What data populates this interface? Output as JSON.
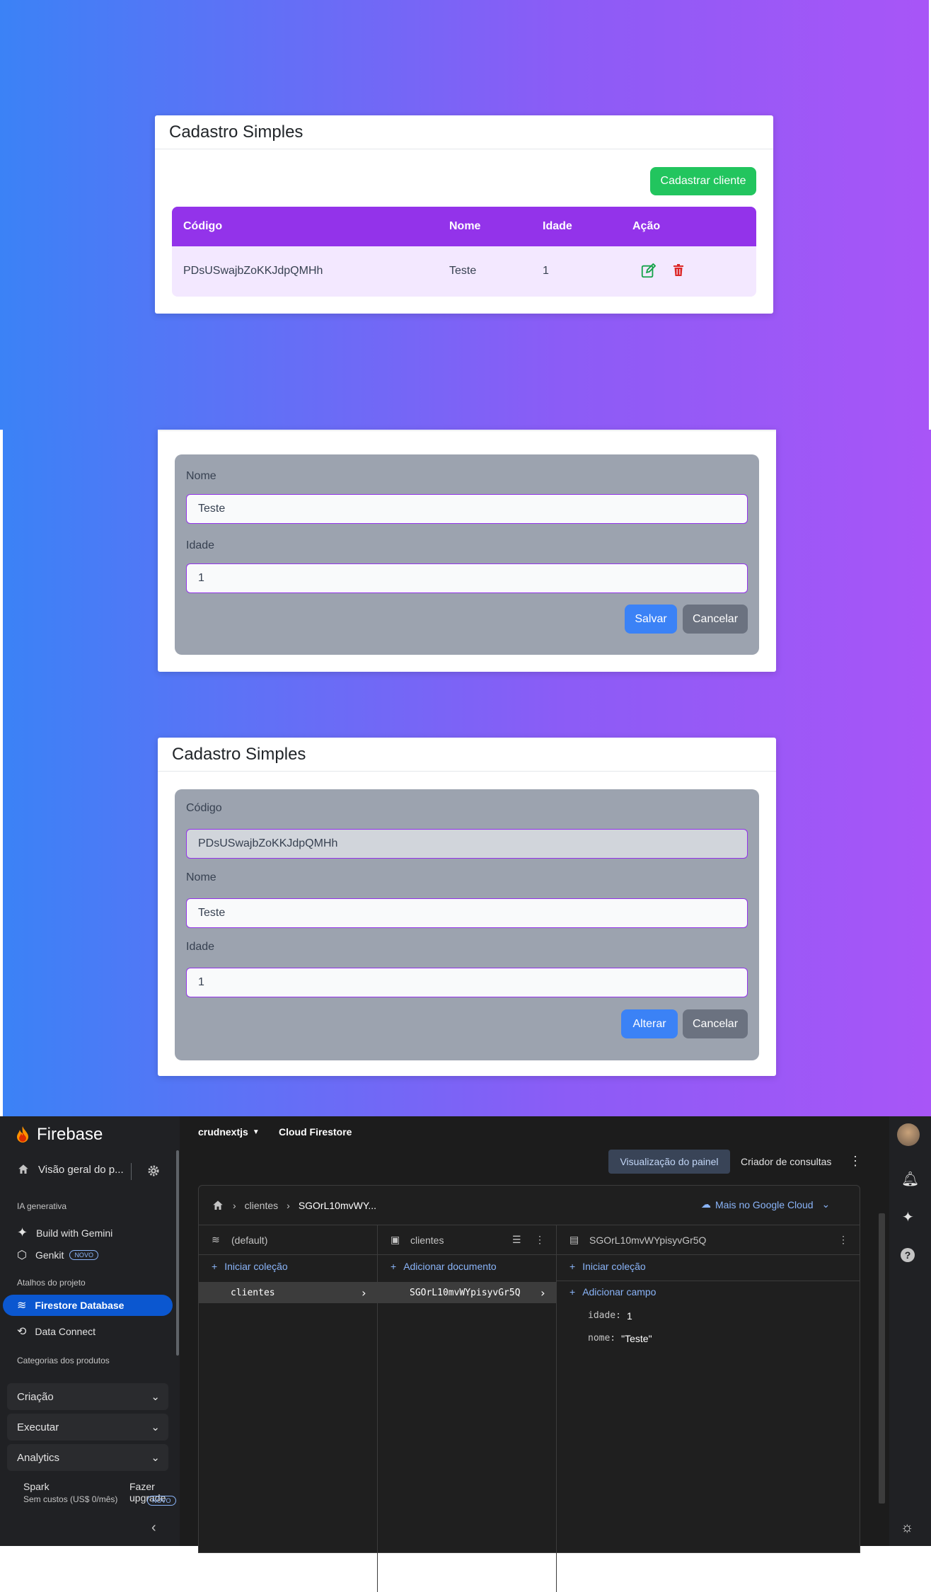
{
  "screen1": {
    "title": "Cadastro Simples",
    "add_button": "Cadastrar cliente",
    "table": {
      "headers": [
        "Código",
        "Nome",
        "Idade",
        "Ação"
      ],
      "rows": [
        {
          "codigo": "PDsUSwajbZoKKJdpQMHh",
          "nome": "Teste",
          "idade": "1"
        }
      ]
    },
    "colors": {
      "header": "#9333ea",
      "row": "#f3e8ff",
      "add": "#22c55e",
      "edit": "#16a34a",
      "delete": "#dc2626"
    }
  },
  "screen2": {
    "fields": [
      {
        "label": "Nome",
        "value": "Teste"
      },
      {
        "label": "Idade",
        "value": "1"
      }
    ],
    "save": "Salvar",
    "cancel": "Cancelar"
  },
  "screen3": {
    "title": "Cadastro Simples",
    "fields": [
      {
        "label": "Código",
        "value": "PDsUSwajbZoKKJdpQMHh"
      },
      {
        "label": "Nome",
        "value": "Teste"
      },
      {
        "label": "Idade",
        "value": "1"
      }
    ],
    "update": "Alterar",
    "cancel": "Cancelar"
  },
  "firebase": {
    "brand": "Firebase",
    "project": "crudnextjs",
    "product": "Cloud Firestore",
    "overview": "Visão geral do p...",
    "section_genai": "IA generativa",
    "build_gemini": "Build with Gemini",
    "genkit": "Genkit",
    "badge_new": "NOVO",
    "section_shortcuts": "Atalhos do projeto",
    "firestore": "Firestore Database",
    "data_connect": "Data Connect",
    "section_categories": "Categorias dos produtos",
    "cat_build": "Criação",
    "cat_run": "Executar",
    "cat_analytics": "Analytics",
    "plan": "Spark",
    "plan_desc": "Sem custos (US$ 0/mês)",
    "upgrade": "Fazer upgrade",
    "view_panel": "Visualização do painel",
    "query_builder": "Criador de consultas",
    "breadcrumb": [
      "clientes",
      "SGOrL10mvWY..."
    ],
    "google_cloud": "Mais no Google Cloud",
    "col1": {
      "title": "(default)",
      "action": "Iniciar coleção",
      "item": "clientes"
    },
    "col2": {
      "title": "clientes",
      "action": "Adicionar documento",
      "item": "SGOrL10mvWYpisyvGr5Q"
    },
    "col3": {
      "title": "SGOrL10mvWYpisyvGr5Q",
      "action1": "Iniciar coleção",
      "action2": "Adicionar campo",
      "fields": [
        {
          "key": "idade:",
          "value": "1"
        },
        {
          "key": "nome:",
          "value": "\"Teste\""
        }
      ]
    }
  }
}
